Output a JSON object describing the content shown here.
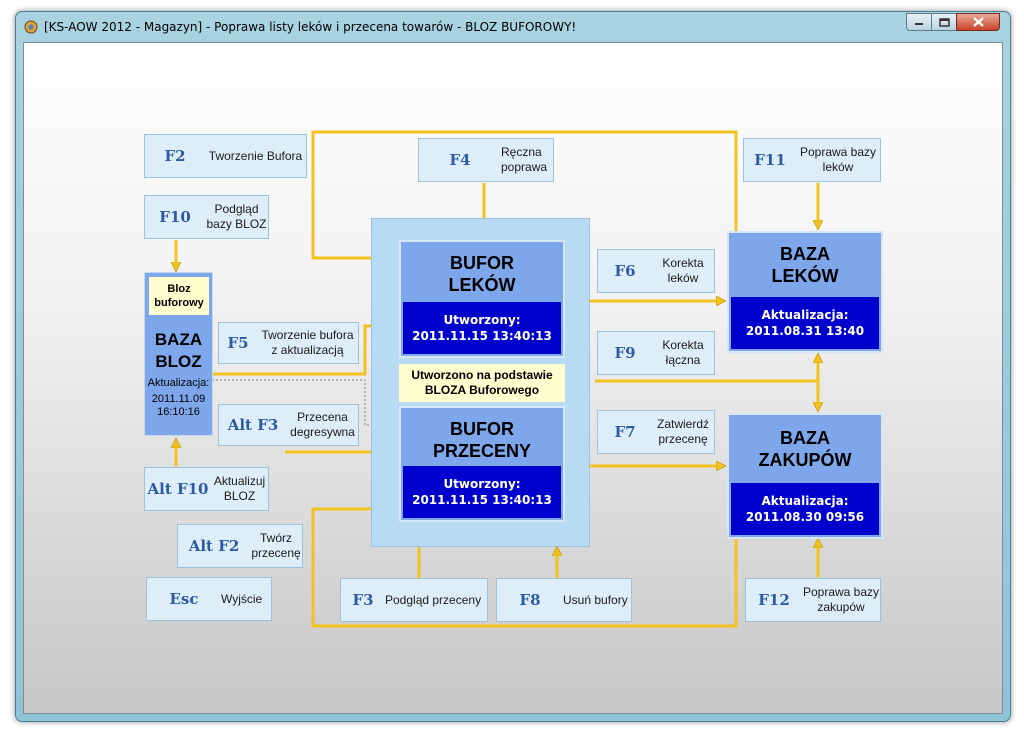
{
  "window": {
    "title": "[KS-AOW 2012 - Magazyn] - Poprawa listy leków i przecena towarów - BLOZ BUFOROWY!"
  },
  "keys": {
    "f2": {
      "key": "F2",
      "desc": "Tworzenie Bufora"
    },
    "f10": {
      "key": "F10",
      "desc": "Podgląd\nbazy BLOZ"
    },
    "f5": {
      "key": "F5",
      "desc": "Tworzenie bufora\nz aktualizacją"
    },
    "alt_f3": {
      "key": "Alt F3",
      "desc": "Przecena\ndegresywna"
    },
    "alt_f10": {
      "key": "Alt F10",
      "desc": "Aktualizuj\nBLOZ"
    },
    "alt_f2": {
      "key": "Alt F2",
      "desc": "Twórz\nprzecenę"
    },
    "esc": {
      "key": "Esc",
      "desc": "Wyjście"
    },
    "f4": {
      "key": "F4",
      "desc": "Ręczna\npoprawa"
    },
    "f3": {
      "key": "F3",
      "desc": "Podgląd przeceny"
    },
    "f8": {
      "key": "F8",
      "desc": "Usuń bufory"
    },
    "f6": {
      "key": "F6",
      "desc": "Korekta\nleków"
    },
    "f9": {
      "key": "F9",
      "desc": "Korekta\nłączna"
    },
    "f7": {
      "key": "F7",
      "desc": "Zatwierdź\nprzecenę"
    },
    "f11": {
      "key": "F11",
      "desc": "Poprawa bazy\nleków"
    },
    "f12": {
      "key": "F12",
      "desc": "Poprawa bazy\nzakupów"
    }
  },
  "bloz": {
    "tag": "Bloz\nbuforowy",
    "title": "BAZA\nBLOZ",
    "update_label": "Aktualizacja:",
    "update_value": "2011.11.09\n16:10:16"
  },
  "bufor_lekow": {
    "title": "BUFOR\nLEKÓW",
    "created_label": "Utworzony:",
    "created_value": "2011.11.15 13:40:13"
  },
  "bufor_przeceny": {
    "title": "BUFOR\nPRZECENY",
    "created_label": "Utworzony:",
    "created_value": "2011.11.15 13:40:13"
  },
  "note": "Utworzono na podstawie\nBLOZA Buforowego",
  "baza_lekow": {
    "title": "BAZA\nLEKÓW",
    "update_label": "Aktualizacja:",
    "update_value": "2011.08.31 13:40"
  },
  "baza_zakupow": {
    "title": "BAZA\nZAKUPÓW",
    "update_label": "Aktualizacja:",
    "update_value": "2011.08.30 09:56"
  },
  "colors": {
    "arrow": "#f2c21e",
    "block_blue": "#7ea6ea",
    "inner_blue": "#0000cc",
    "key_blue": "#2d5aa2"
  }
}
